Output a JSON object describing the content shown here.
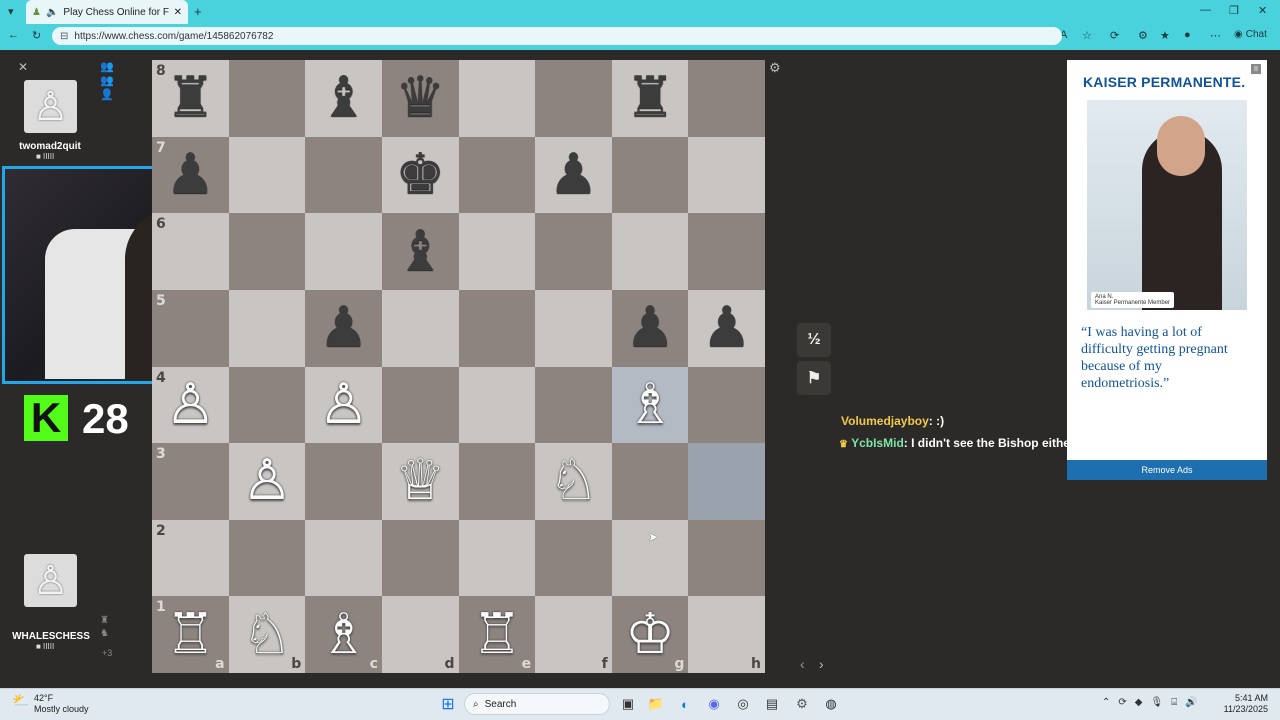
{
  "browser": {
    "tab_title": "Play Chess Online for FREE",
    "url": "https://www.chess.com/game/145862076782",
    "chat_label": "Chat"
  },
  "players": {
    "top": {
      "name": "twomad2quit",
      "flag": "■ IIIII"
    },
    "bottom": {
      "name": "WHALESCHESS",
      "flag": "■ IIIII",
      "extra": "+3"
    }
  },
  "stream": {
    "viewer_count": "28"
  },
  "board": {
    "rows": [
      [
        "b:♜",
        "",
        "b:♝",
        "b:♛",
        "",
        "",
        "b:♜",
        ""
      ],
      [
        "b:♟",
        "",
        "",
        "b:♚",
        "",
        "b:♟",
        "",
        ""
      ],
      [
        "",
        "",
        "",
        "b:♝",
        "",
        "",
        "",
        ""
      ],
      [
        "",
        "",
        "b:♟",
        "",
        "",
        "",
        "b:♟",
        "b:♟"
      ],
      [
        "w:♙",
        "",
        "w:♙",
        "",
        "",
        "",
        "w:♗",
        ""
      ],
      [
        "",
        "w:♙",
        "",
        "w:♕",
        "",
        "w:♘",
        "",
        ""
      ],
      [
        "",
        "",
        "",
        "",
        "",
        "",
        "",
        ""
      ],
      [
        "w:♖",
        "w:♘",
        "w:♗",
        "",
        "w:♖",
        "",
        "w:♔",
        ""
      ]
    ],
    "ranks": [
      "8",
      "7",
      "6",
      "5",
      "4",
      "3",
      "2",
      "1"
    ],
    "files": [
      "a",
      "b",
      "c",
      "d",
      "e",
      "f",
      "g",
      "h"
    ]
  },
  "controls": {
    "draw_label": "½",
    "resign_icon": "flag-icon"
  },
  "chat": [
    {
      "user": "Volumedjayboy",
      "text": ": :)",
      "color": "#f0c94a"
    },
    {
      "user": "YcbIsMid",
      "text": ": I didn't see the Bishop either I thought you coulda won there",
      "color": "#7ee3a8"
    }
  ],
  "ad": {
    "brand": "KAISER PERMANENTE.",
    "caption_name": "Ana N.",
    "caption_role": "Kaiser Permanente Member",
    "quote": "“I was having a lot of difficulty getting pregnant because of my endometriosis.”",
    "remove": "Remove Ads"
  },
  "taskbar": {
    "weather_temp": "42°F",
    "weather_desc": "Mostly cloudy",
    "search_label": "Search",
    "time": "5:41 AM",
    "date": "11/23/2025"
  }
}
